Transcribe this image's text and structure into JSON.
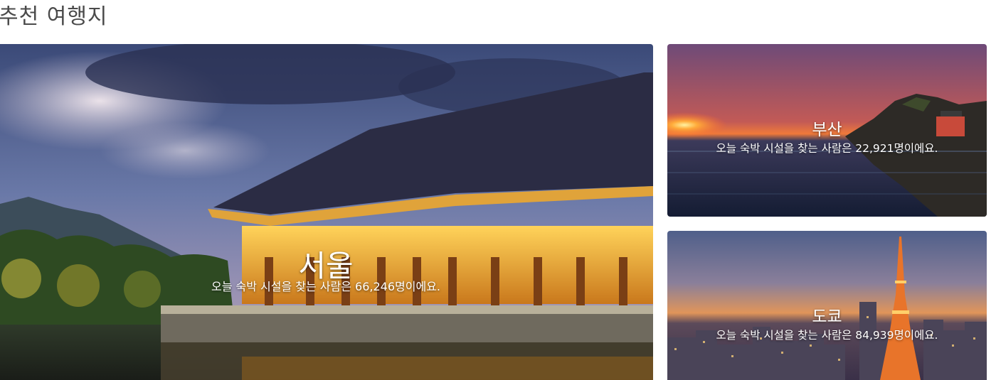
{
  "section": {
    "title": "추천 여행지"
  },
  "destinations": [
    {
      "city": "서울",
      "description": "오늘 숙박 시설을 찾는 사람은 66,246명이에요."
    },
    {
      "city": "부산",
      "description": "오늘 숙박 시설을 찾는 사람은 22,921명이에요."
    },
    {
      "city": "도쿄",
      "description": "오늘 숙박 시설을 찾는 사람은 84,939명이에요."
    }
  ]
}
